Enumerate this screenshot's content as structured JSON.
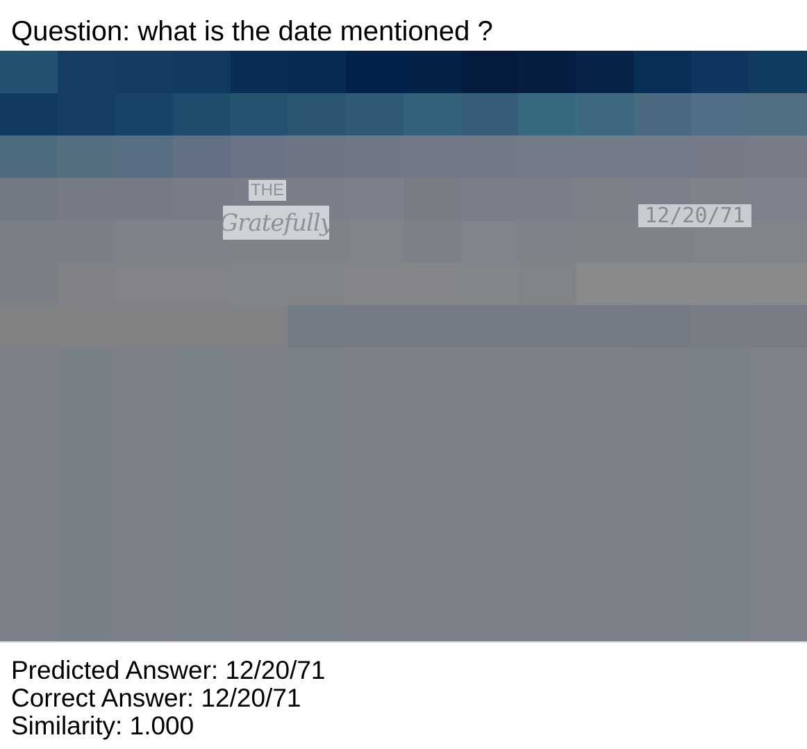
{
  "question": {
    "text": "Question: what is the date mentioned ?"
  },
  "image": {
    "crops": {
      "the": "THE",
      "script": "Gratefully",
      "date": "12/20/71"
    },
    "mosaic_colors": [
      [
        "#225172",
        "#153e62",
        "#143d62",
        "#113a60",
        "#082e56",
        "#072b53",
        "#03224a",
        "#042148",
        "#041b3d",
        "#041d41",
        "#062349",
        "#073057",
        "#0e365e",
        "#113c62",
        "#143e62"
      ],
      [
        "#113a60",
        "#143e62",
        "#174466",
        "#1d4c6c",
        "#255270",
        "#2a5673",
        "#2f5a77",
        "#33617b",
        "#365e7c",
        "#376a80",
        "#3d6a82",
        "#4a6a80",
        "#4f6f84",
        "#526e82",
        "#55707f"
      ],
      [
        "#4f6b7f",
        "#556f80",
        "#586e82",
        "#626f84",
        "#6a7486",
        "#6e7685",
        "#707887",
        "#727888",
        "#727a88",
        "#747a88",
        "#737b88",
        "#747b89",
        "#767b87",
        "#787d89",
        "#787d89"
      ],
      [
        "#737985",
        "#767b86",
        "#777b87",
        "#787c87",
        "#7a7e89",
        "#7c7f8a",
        "#7d808b",
        "#777c85",
        "#7a7e89",
        "#7a7f89",
        "#7c8089",
        "#7d808a",
        "#7e828b",
        "#7e818b",
        "#7e818b"
      ],
      [
        "#7b7f86",
        "#7c7f87",
        "#7e8187",
        "#7f8288",
        "#7f8388",
        "#7f8287",
        "#808388",
        "#7c8089",
        "#808389",
        "#7f8288",
        "#7f8388",
        "#7f8388",
        "#808489",
        "#818489",
        "#818489"
      ],
      [
        "#7c7f85",
        "#808287",
        "#818387",
        "#818387",
        "#818488",
        "#828588",
        "#838589",
        "#838589",
        "#828589",
        "#818487",
        "#888a8b",
        "#888a8b",
        "#888a8b",
        "#888a8b",
        "#888a8b"
      ],
      [
        "#808182",
        "#808182",
        "#808182",
        "#808182",
        "#808182",
        "#737b84",
        "#757c85",
        "#767c85",
        "#767c85",
        "#757c85",
        "#757c85",
        "#747b84",
        "#787d86",
        "#777c85",
        "#787d86"
      ],
      [
        "#7b8089",
        "#7a8088",
        "#7c8189",
        "#7b8189",
        "#7c8189",
        "#7b8189",
        "#7c8189",
        "#7c8189",
        "#7c8189",
        "#7c8189",
        "#7c8189",
        "#7c8189",
        "#7b8189",
        "#7d828a",
        "#7c8189"
      ]
    ]
  },
  "results": {
    "predicted": "Predicted Answer: 12/20/71",
    "correct": "Correct Answer: 12/20/71",
    "similarity": "Similarity: 1.000"
  }
}
